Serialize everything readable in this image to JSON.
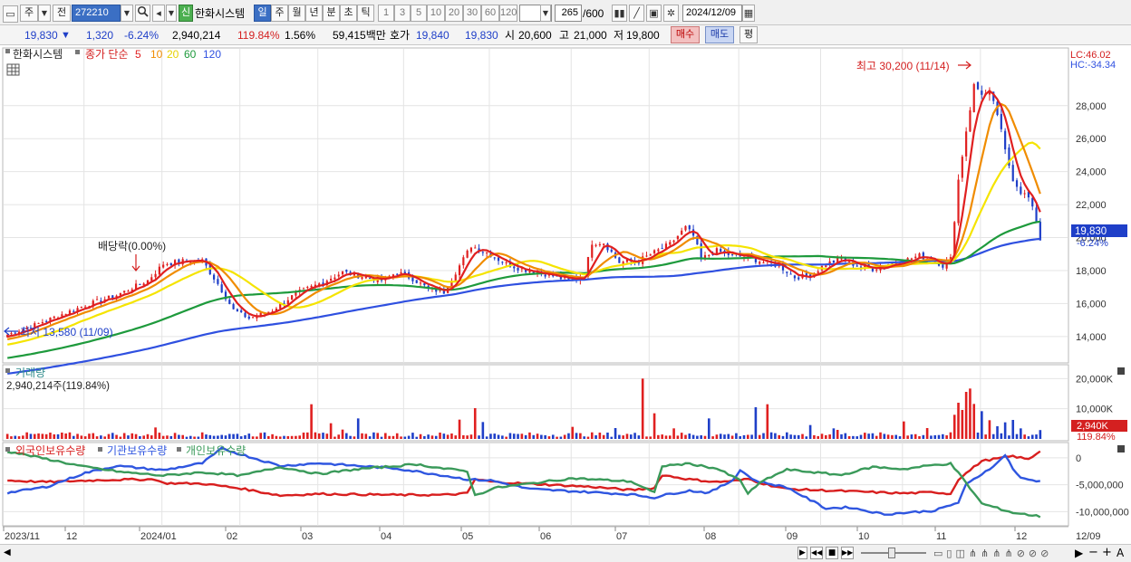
{
  "toolbar": {
    "market_type": "주",
    "compare_label": "전",
    "stock_code": "272210",
    "credit_badge": "신",
    "stock_name": "한화시스템",
    "periods": [
      "일",
      "주",
      "월",
      "년",
      "분",
      "초",
      "틱"
    ],
    "active_period": "일",
    "intervals": [
      "1",
      "3",
      "5",
      "10",
      "20",
      "30",
      "60",
      "120"
    ],
    "count": "265",
    "count_total": "/600",
    "date": "2024/12/09"
  },
  "quote": {
    "price": "19,830",
    "change": "1,320",
    "change_pct": "-6.24%",
    "volume": "2,940,214",
    "volume_ratio": "119.84%",
    "turnover": "1.56%",
    "amount": "59,415백만",
    "bid_label": "호가",
    "bid": "19,840",
    "ask": "19,830",
    "open_label": "시",
    "open": "20,600",
    "high_label": "고",
    "high": "21,000",
    "low_label": "저",
    "low": "19,800",
    "buy_label": "매수",
    "sell_label": "매도",
    "avg_label": "평"
  },
  "colors": {
    "candle_up": "#e02020",
    "candle_down": "#1f3fc8",
    "ma5": "#e02020",
    "ma10": "#f08c00",
    "ma20": "#f5e400",
    "ma60": "#1e9a3c",
    "ma120": "#2f50e0",
    "foreign": "#d81e1e",
    "institution": "#2f56e0",
    "individual": "#3a9a5a"
  },
  "chart_data": [
    {
      "type": "candlestick",
      "name": "price",
      "legend": {
        "stock": "한화시스템",
        "ma_prefix": "종가 단순",
        "periods": [
          "5",
          "10",
          "20",
          "60",
          "120"
        ]
      },
      "x_labels": [
        "2023/11",
        "12",
        "2024/01",
        "02",
        "03",
        "04",
        "05",
        "06",
        "07",
        "08",
        "09",
        "10",
        "11",
        "12",
        "12/09"
      ],
      "y_ticks": [
        "14,000",
        "16,000",
        "18,000",
        "20,000",
        "22,000",
        "24,000",
        "26,000",
        "28,000"
      ],
      "ylim": [
        12400,
        31500
      ],
      "lc": "LC:46.02",
      "hc": "HC:-34.34",
      "current_price": "19,830",
      "current_pct": "-6.24%",
      "annotations": {
        "high": "최고 30,200 (11/14)",
        "low": "최저 13,580 (11/09)",
        "dividend": "배당락(0.00%)"
      },
      "close_anchors": [
        [
          0,
          14100
        ],
        [
          8,
          14800
        ],
        [
          20,
          15900
        ],
        [
          28,
          16500
        ],
        [
          36,
          17400
        ],
        [
          40,
          18400
        ],
        [
          46,
          18600
        ],
        [
          50,
          18600
        ],
        [
          54,
          17200
        ],
        [
          58,
          15600
        ],
        [
          62,
          15100
        ],
        [
          68,
          15600
        ],
        [
          74,
          16600
        ],
        [
          80,
          17200
        ],
        [
          86,
          17900
        ],
        [
          92,
          17600
        ],
        [
          96,
          17400
        ],
        [
          100,
          17900
        ],
        [
          104,
          17500
        ],
        [
          108,
          16900
        ],
        [
          112,
          16700
        ],
        [
          115,
          17900
        ],
        [
          119,
          19500
        ],
        [
          123,
          19100
        ],
        [
          128,
          18400
        ],
        [
          132,
          18100
        ],
        [
          138,
          17800
        ],
        [
          144,
          17400
        ],
        [
          148,
          17700
        ],
        [
          150,
          19700
        ],
        [
          153,
          19700
        ],
        [
          157,
          18500
        ],
        [
          162,
          18600
        ],
        [
          166,
          19100
        ],
        [
          170,
          19600
        ],
        [
          174,
          20600
        ],
        [
          176,
          20100
        ],
        [
          178,
          18700
        ],
        [
          182,
          19200
        ],
        [
          186,
          18900
        ],
        [
          190,
          18800
        ],
        [
          194,
          18500
        ],
        [
          198,
          18300
        ],
        [
          202,
          17600
        ],
        [
          206,
          17700
        ],
        [
          210,
          18400
        ],
        [
          214,
          18700
        ],
        [
          218,
          18300
        ],
        [
          222,
          18100
        ],
        [
          226,
          18400
        ],
        [
          230,
          18600
        ],
        [
          234,
          18900
        ],
        [
          238,
          18600
        ],
        [
          240,
          18300
        ],
        [
          242,
          18700
        ],
        [
          244,
          23500
        ],
        [
          246,
          26500
        ],
        [
          248,
          29200
        ],
        [
          250,
          28800
        ],
        [
          252,
          28600
        ],
        [
          254,
          27500
        ],
        [
          256,
          25200
        ],
        [
          258,
          23600
        ],
        [
          260,
          22800
        ],
        [
          262,
          22400
        ],
        [
          264,
          21000
        ],
        [
          265,
          19830
        ]
      ]
    },
    {
      "type": "bar",
      "name": "volume",
      "title": "거래량",
      "summary": "2,940,214주(119.84%)",
      "y_ticks": [
        "20,000K",
        "10,000K"
      ],
      "ylim": [
        0,
        21000
      ],
      "current": "2,940K",
      "current_pct": "119.84%",
      "spikes": [
        [
          38,
          3800
        ],
        [
          78,
          11500
        ],
        [
          83,
          5200
        ],
        [
          86,
          3100
        ],
        [
          90,
          6800
        ],
        [
          116,
          6400
        ],
        [
          120,
          10200
        ],
        [
          122,
          5600
        ],
        [
          145,
          4000
        ],
        [
          156,
          3600
        ],
        [
          163,
          20000
        ],
        [
          166,
          8500
        ],
        [
          171,
          3500
        ],
        [
          180,
          6800
        ],
        [
          192,
          10500
        ],
        [
          195,
          11500
        ],
        [
          206,
          4600
        ],
        [
          212,
          3500
        ],
        [
          213,
          3000
        ],
        [
          230,
          5800
        ],
        [
          236,
          3600
        ],
        [
          243,
          8000
        ],
        [
          244,
          12000
        ],
        [
          245,
          9600
        ],
        [
          246,
          15600
        ],
        [
          247,
          16700
        ],
        [
          248,
          11600
        ],
        [
          250,
          9200
        ],
        [
          252,
          6200
        ],
        [
          254,
          4200
        ],
        [
          256,
          5500
        ],
        [
          258,
          6300
        ],
        [
          260,
          3500
        ],
        [
          265,
          2940
        ]
      ]
    },
    {
      "type": "line",
      "name": "holdings",
      "series": [
        {
          "name": "외국인보유수량",
          "values": [
            [
              0,
              -4200000
            ],
            [
              10,
              -4500000
            ],
            [
              25,
              -4100000
            ],
            [
              38,
              -4000000
            ],
            [
              40,
              -4700000
            ],
            [
              50,
              -4800000
            ],
            [
              60,
              -5700000
            ],
            [
              70,
              -7000000
            ],
            [
              80,
              -6700000
            ],
            [
              100,
              -6900000
            ],
            [
              112,
              -6900000
            ],
            [
              118,
              -6600000
            ],
            [
              120,
              -4000000
            ],
            [
              125,
              -4500000
            ],
            [
              150,
              -5400000
            ],
            [
              160,
              -6000000
            ],
            [
              166,
              -5600000
            ],
            [
              168,
              -3200000
            ],
            [
              175,
              -4000000
            ],
            [
              182,
              -4500000
            ],
            [
              188,
              -4200000
            ],
            [
              190,
              -3900000
            ],
            [
              194,
              -4800000
            ],
            [
              200,
              -5800000
            ],
            [
              230,
              -6600000
            ],
            [
              238,
              -6400000
            ],
            [
              242,
              -6700000
            ],
            [
              244,
              -4000000
            ],
            [
              250,
              -600000
            ],
            [
              258,
              300000
            ],
            [
              262,
              -300000
            ],
            [
              266,
              1800000
            ]
          ]
        },
        {
          "name": "기관보유수량",
          "values": [
            [
              0,
              -6500000
            ],
            [
              10,
              -5400000
            ],
            [
              20,
              -2800000
            ],
            [
              28,
              -1500000
            ],
            [
              40,
              -2300000
            ],
            [
              50,
              -1000000
            ],
            [
              55,
              1700000
            ],
            [
              62,
              200000
            ],
            [
              70,
              -1500000
            ],
            [
              80,
              -1000000
            ],
            [
              100,
              -2000000
            ],
            [
              112,
              -3300000
            ],
            [
              118,
              -4000000
            ],
            [
              124,
              -4200000
            ],
            [
              134,
              -5800000
            ],
            [
              150,
              -6400000
            ],
            [
              160,
              -6800000
            ],
            [
              166,
              -7400000
            ],
            [
              170,
              -6700000
            ],
            [
              175,
              -6100000
            ],
            [
              180,
              -6500000
            ],
            [
              186,
              -4200000
            ],
            [
              188,
              -2300000
            ],
            [
              192,
              -4300000
            ],
            [
              200,
              -5500000
            ],
            [
              210,
              -9400000
            ],
            [
              216,
              -9200000
            ],
            [
              225,
              -10500000
            ],
            [
              238,
              -9800000
            ],
            [
              244,
              -8300000
            ],
            [
              246,
              -5000000
            ],
            [
              250,
              -3000000
            ],
            [
              254,
              -1000000
            ],
            [
              256,
              600000
            ],
            [
              258,
              -2000000
            ],
            [
              260,
              -3800000
            ],
            [
              266,
              -4500000
            ]
          ]
        },
        {
          "name": "개인보유수량",
          "values": [
            [
              0,
              1200000
            ],
            [
              10,
              -200000
            ],
            [
              20,
              -1700000
            ],
            [
              30,
              -2700000
            ],
            [
              40,
              -3300000
            ],
            [
              50,
              -2700000
            ],
            [
              60,
              -3300000
            ],
            [
              70,
              -1700000
            ],
            [
              80,
              -3000000
            ],
            [
              90,
              -2100000
            ],
            [
              105,
              -1200000
            ],
            [
              112,
              -2000000
            ],
            [
              118,
              -2500000
            ],
            [
              120,
              -7000000
            ],
            [
              125,
              -5600000
            ],
            [
              135,
              -4700000
            ],
            [
              145,
              -3800000
            ],
            [
              160,
              -4400000
            ],
            [
              166,
              -6500000
            ],
            [
              168,
              -1500000
            ],
            [
              175,
              -1100000
            ],
            [
              182,
              -2000000
            ],
            [
              188,
              -4200000
            ],
            [
              190,
              -6600000
            ],
            [
              194,
              -4200000
            ],
            [
              200,
              -2200000
            ],
            [
              214,
              -3200000
            ],
            [
              222,
              -1700000
            ],
            [
              230,
              -2100000
            ],
            [
              238,
              -1300000
            ],
            [
              242,
              -1100000
            ],
            [
              244,
              -2800000
            ],
            [
              250,
              -8500000
            ],
            [
              258,
              -10200000
            ],
            [
              266,
              -11000000
            ]
          ]
        }
      ],
      "y_ticks": [
        "0",
        "-5,000,000",
        "-10,000,000"
      ],
      "ylim": [
        -12300000,
        2500000
      ]
    }
  ]
}
